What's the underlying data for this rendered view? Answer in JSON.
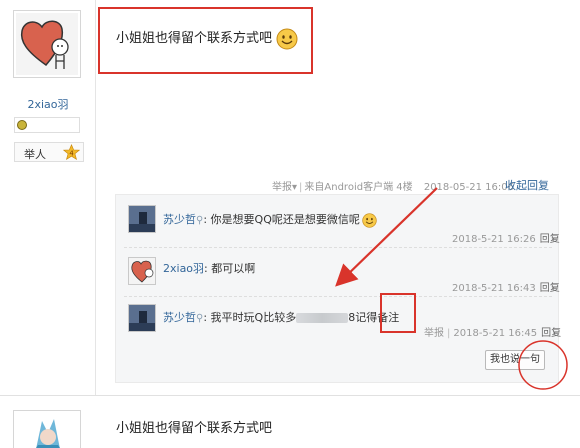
{
  "author": {
    "name": "2xiao羽",
    "rank_label": "举人",
    "rank_level": "4"
  },
  "post": {
    "content": "小姐姐也得留个联系方式吧"
  },
  "meta": {
    "report": "举报",
    "source": "来自Android客户端",
    "floor": "4楼",
    "time": "2018-05-21 16:06",
    "collapse": "收起回复"
  },
  "comments": [
    {
      "user": "苏少哲",
      "text": "你是想要QQ呢还是想要微信呢",
      "time": "2018-5-21 16:26",
      "reply": "回复",
      "has_location": true,
      "has_emoji": true
    },
    {
      "user": "2xiao羽",
      "text": "都可以啊",
      "time": "2018-5-21 16:43",
      "reply": "回复",
      "has_location": false,
      "has_emoji": false
    },
    {
      "user": "苏少哲",
      "text_before": "我平时玩Q比较多",
      "text_after": "8记得备注",
      "report": "举报",
      "time": "2018-5-21 16:45",
      "reply": "回复",
      "has_location": true
    }
  ],
  "reply_button": "我也说一句",
  "second_post": {
    "content": "小姐姐也得留个联系方式吧"
  },
  "colors": {
    "link": "#336699",
    "annotation_red": "#d9342b",
    "comment_bg": "#f5f6f7"
  },
  "icons": [
    "heart-avatar-icon",
    "medal-icon",
    "rank-star-icon",
    "smiley-icon",
    "location-pin-icon",
    "dropdown-caret-icon"
  ]
}
